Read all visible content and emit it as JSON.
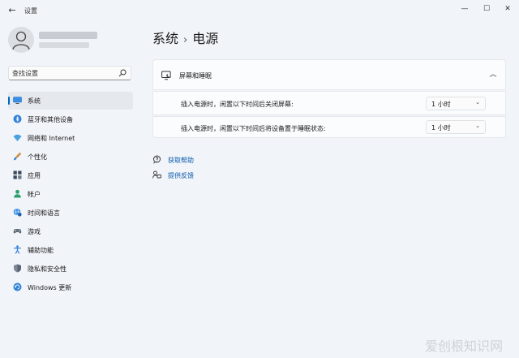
{
  "window": {
    "title": "设置",
    "back_icon": "back-arrow-icon",
    "controls": {
      "minimize": "—",
      "maximize": "☐",
      "close": "✕"
    }
  },
  "search": {
    "placeholder": "查找设置",
    "icon": "search-icon"
  },
  "sidebar": {
    "items": [
      {
        "label": "系统",
        "icon": "display-icon",
        "selected": true
      },
      {
        "label": "蓝牙和其他设备",
        "icon": "bluetooth-icon"
      },
      {
        "label": "网络和 Internet",
        "icon": "wifi-icon"
      },
      {
        "label": "个性化",
        "icon": "brush-icon"
      },
      {
        "label": "应用",
        "icon": "apps-icon"
      },
      {
        "label": "帐户",
        "icon": "person-icon"
      },
      {
        "label": "时间和语言",
        "icon": "globe-clock-icon"
      },
      {
        "label": "游戏",
        "icon": "gamepad-icon"
      },
      {
        "label": "辅助功能",
        "icon": "accessibility-icon"
      },
      {
        "label": "隐私和安全性",
        "icon": "shield-icon"
      },
      {
        "label": "Windows 更新",
        "icon": "update-icon"
      }
    ]
  },
  "main": {
    "breadcrumb": {
      "parent": "系统",
      "separator": "›",
      "current": "电源"
    },
    "section": {
      "title": "屏幕和睡眠",
      "icon": "screen-sleep-icon",
      "rows": [
        {
          "label": "插入电源时，闲置以下时间后关闭屏幕:",
          "value": "1 小时"
        },
        {
          "label": "插入电源时，闲置以下时间后将设备置于睡眠状态:",
          "value": "1 小时"
        }
      ]
    },
    "links": [
      {
        "label": "获取帮助",
        "icon": "help-icon"
      },
      {
        "label": "提供反馈",
        "icon": "feedback-icon"
      }
    ]
  },
  "watermark": {
    "text": "爱创根知识网"
  },
  "colors": {
    "accent": "#0067c0",
    "link": "#0a5bab",
    "background": "#f1f4f9"
  }
}
